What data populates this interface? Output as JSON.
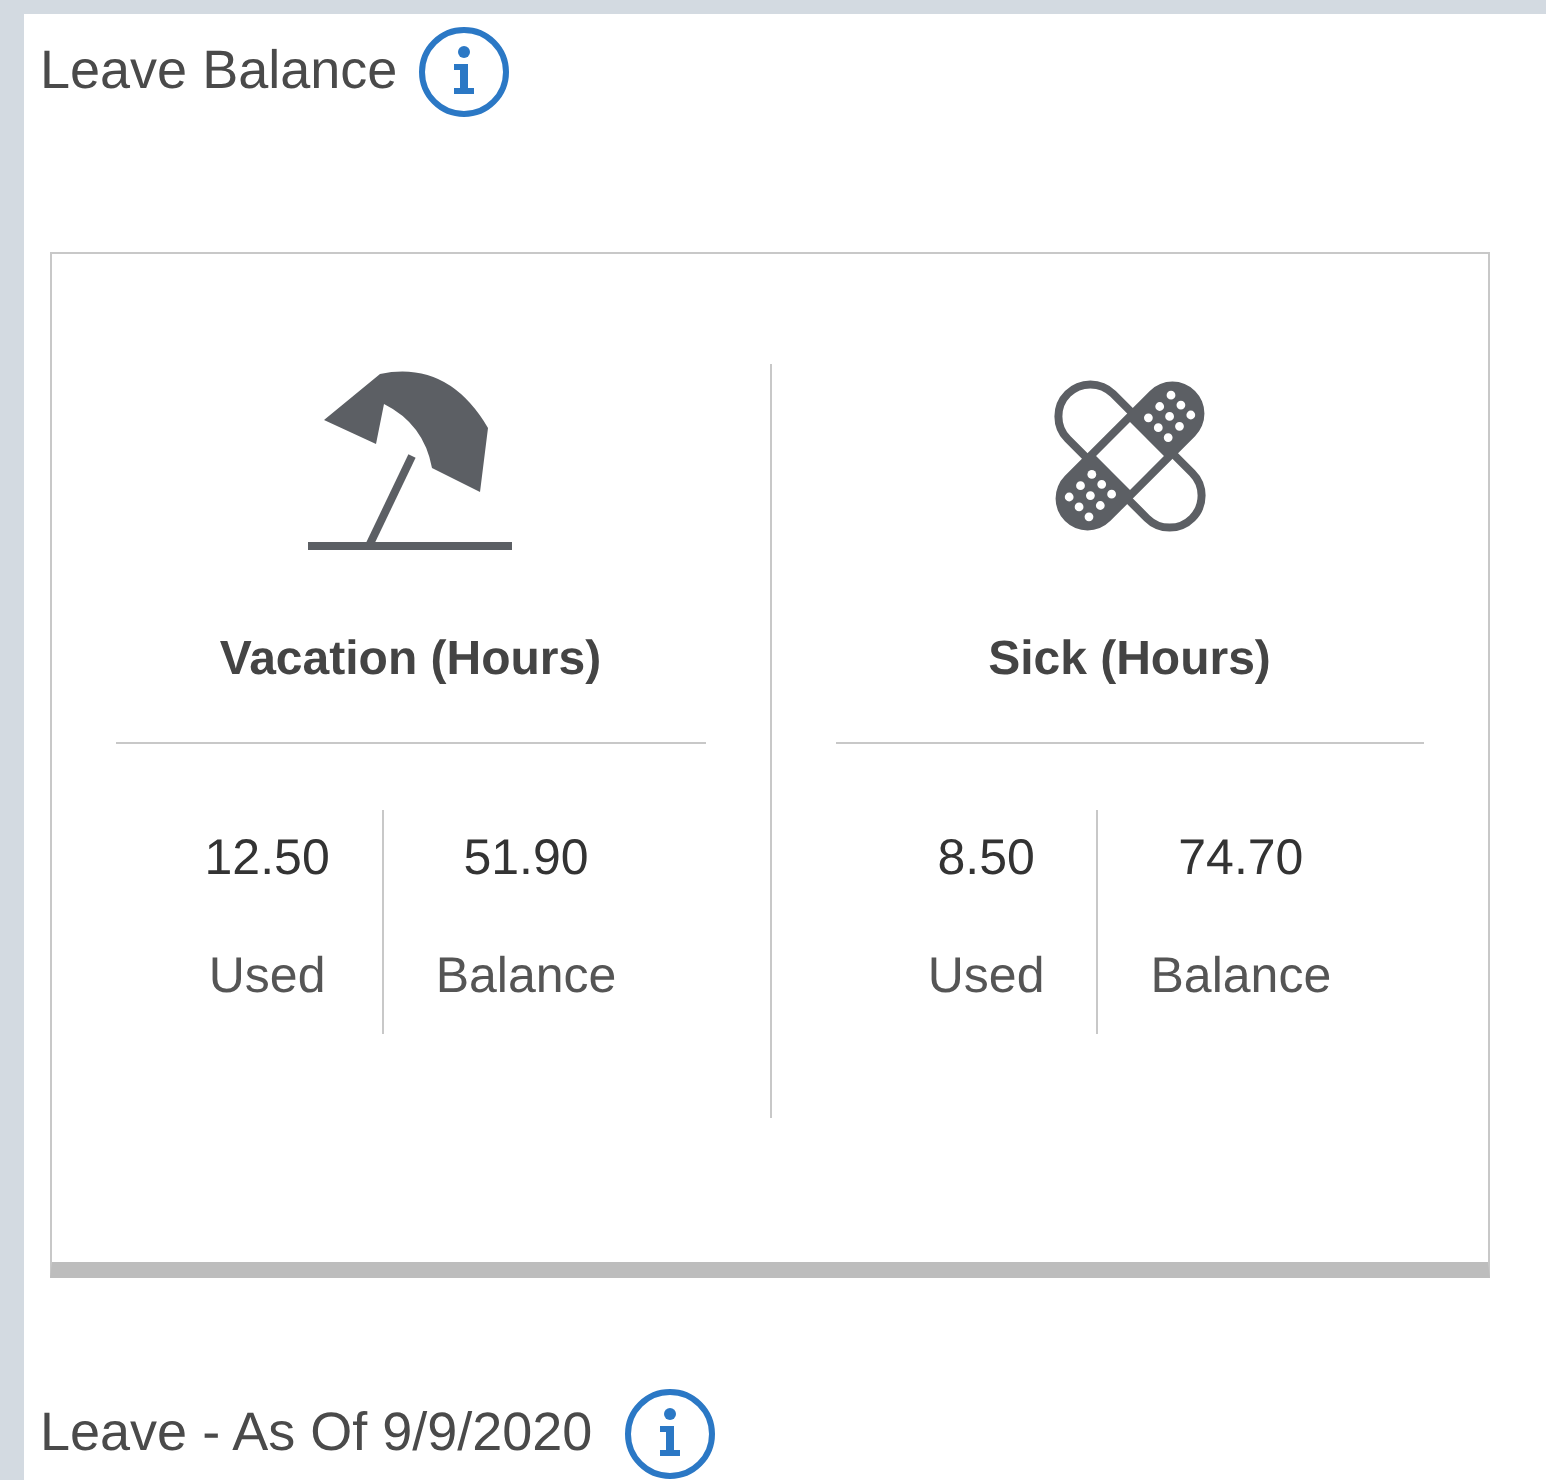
{
  "header": {
    "title": "Leave Balance"
  },
  "categories": [
    {
      "kind": "vacation",
      "title": "Vacation (Hours)",
      "stats": [
        {
          "value": "12.50",
          "label": "Used"
        },
        {
          "value": "51.90",
          "label": "Balance"
        }
      ]
    },
    {
      "kind": "sick",
      "title": "Sick (Hours)",
      "stats": [
        {
          "value": "8.50",
          "label": "Used"
        },
        {
          "value": "74.70",
          "label": "Balance"
        }
      ]
    }
  ],
  "footer": {
    "title": "Leave - As Of 9/9/2020"
  }
}
